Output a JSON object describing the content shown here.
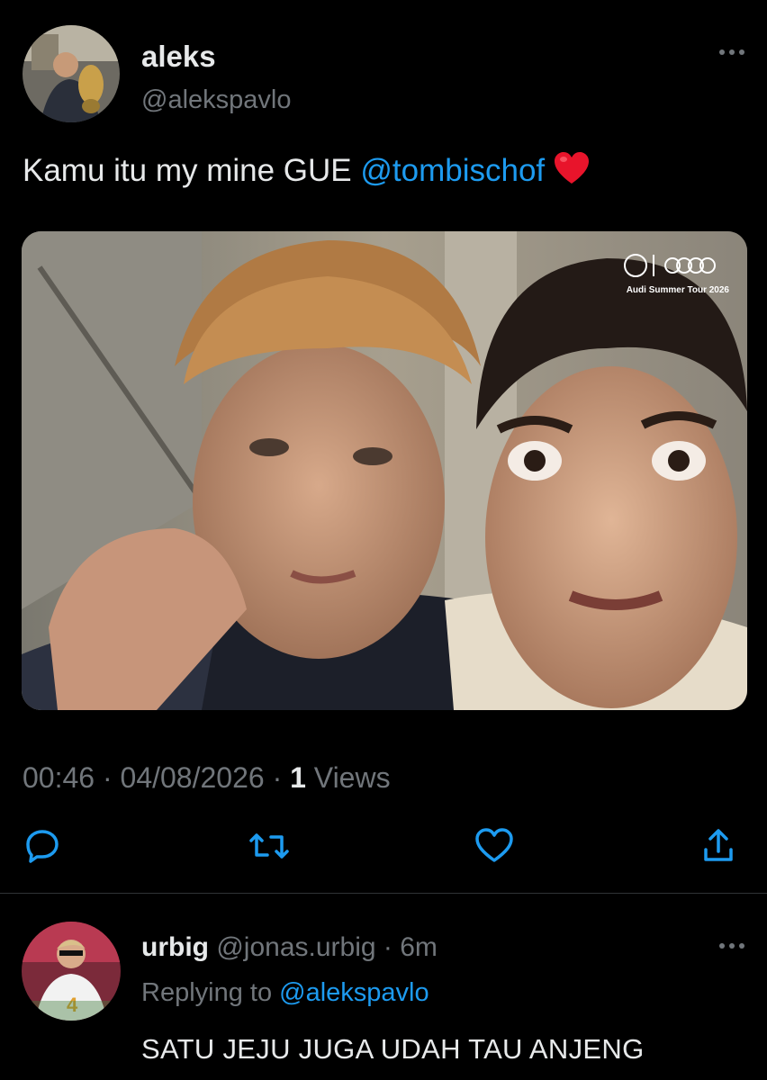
{
  "tweet": {
    "author_name": "aleks",
    "author_handle": "@alekspavlo",
    "text_before_mention": "Kamu itu my mine GUE ",
    "mention": "@tombischof",
    "media_watermark_line": "Audi Summer Tour 2026",
    "time": "00:46",
    "date": "04/08/2026",
    "views_count": "1",
    "views_label": "Views",
    "separator": "·"
  },
  "icons": {
    "more": "more-horizontal-icon",
    "reply": "reply-icon",
    "retweet": "retweet-icon",
    "like": "like-icon",
    "share": "share-icon",
    "emoji": "red-heart-emoji"
  },
  "reply": {
    "author_name": "urbig",
    "author_handle": "@jonas.urbig",
    "age": "· 6m",
    "replying_prefix": "Replying to ",
    "replying_to": "@alekspavlo",
    "text": "SATU JEJU JUGA UDAH TAU ANJENG"
  },
  "colors": {
    "background": "#000000",
    "text": "#e7e9ea",
    "secondary": "#71767b",
    "accent": "#1d9bf0",
    "heart": "#e0245e"
  }
}
